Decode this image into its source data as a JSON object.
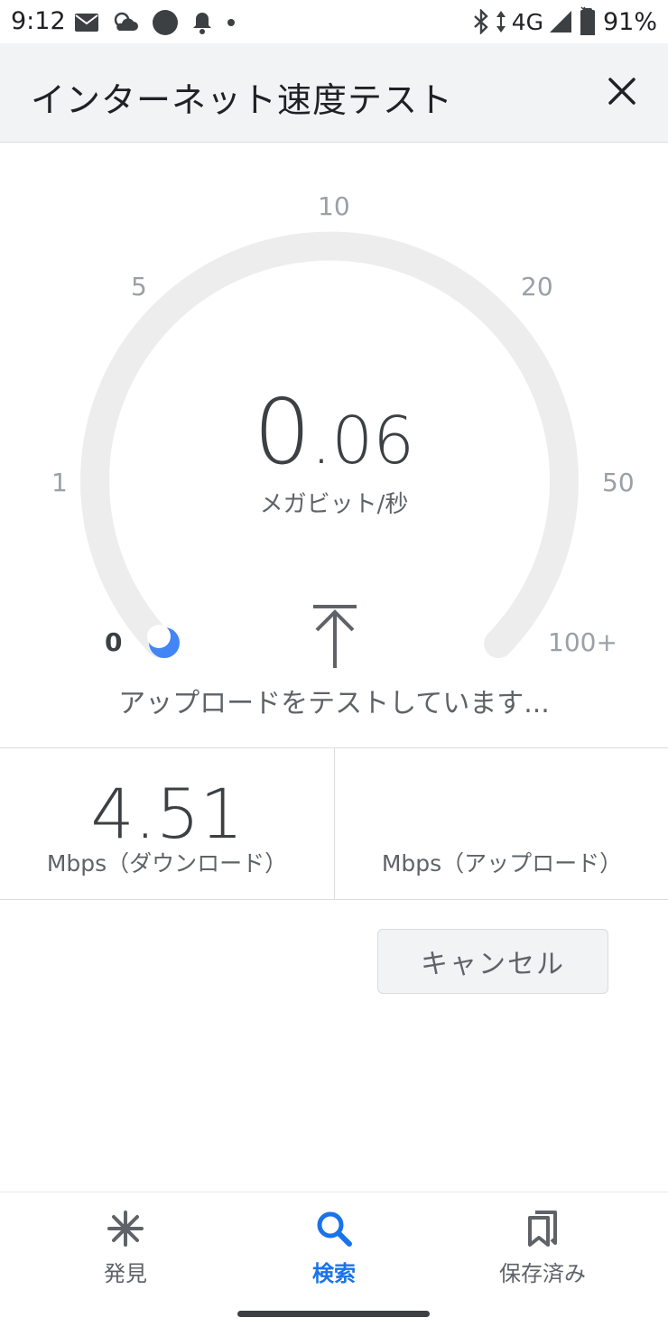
{
  "status_bar": {
    "time": "9:12",
    "network": "4G",
    "battery": "91%",
    "icons_left": [
      "mail-icon",
      "weather-icon",
      "circle-icon",
      "bell-icon",
      "dot-icon"
    ],
    "icons_right": [
      "bluetooth-icon",
      "data-arrows-icon",
      "signal-icon",
      "battery-icon"
    ]
  },
  "app_bar": {
    "title": "インターネット速度テスト",
    "close_icon": "close-icon"
  },
  "gauge": {
    "ticks": [
      "0",
      "1",
      "5",
      "10",
      "20",
      "50",
      "100+"
    ],
    "active_tick": "0",
    "current_speed_int": "0",
    "current_speed_dec": ".06",
    "unit": "メガビット/秒",
    "status": "アップロードをテストしています...",
    "phase_icon": "upload-arrow-icon",
    "track_color": "#ededed",
    "indicator_color": "#4285f4"
  },
  "results": {
    "download_value": "4.51",
    "download_label": "Mbps（ダウンロード）",
    "upload_value": "",
    "upload_label": "Mbps（アップロード）"
  },
  "actions": {
    "cancel_label": "キャンセル"
  },
  "bottom_nav": {
    "items": [
      {
        "label": "発見",
        "icon": "asterisk-icon",
        "active": false
      },
      {
        "label": "検索",
        "icon": "search-icon",
        "active": true
      },
      {
        "label": "保存済み",
        "icon": "bookmarks-icon",
        "active": false
      }
    ],
    "active_color": "#1a73e8"
  }
}
